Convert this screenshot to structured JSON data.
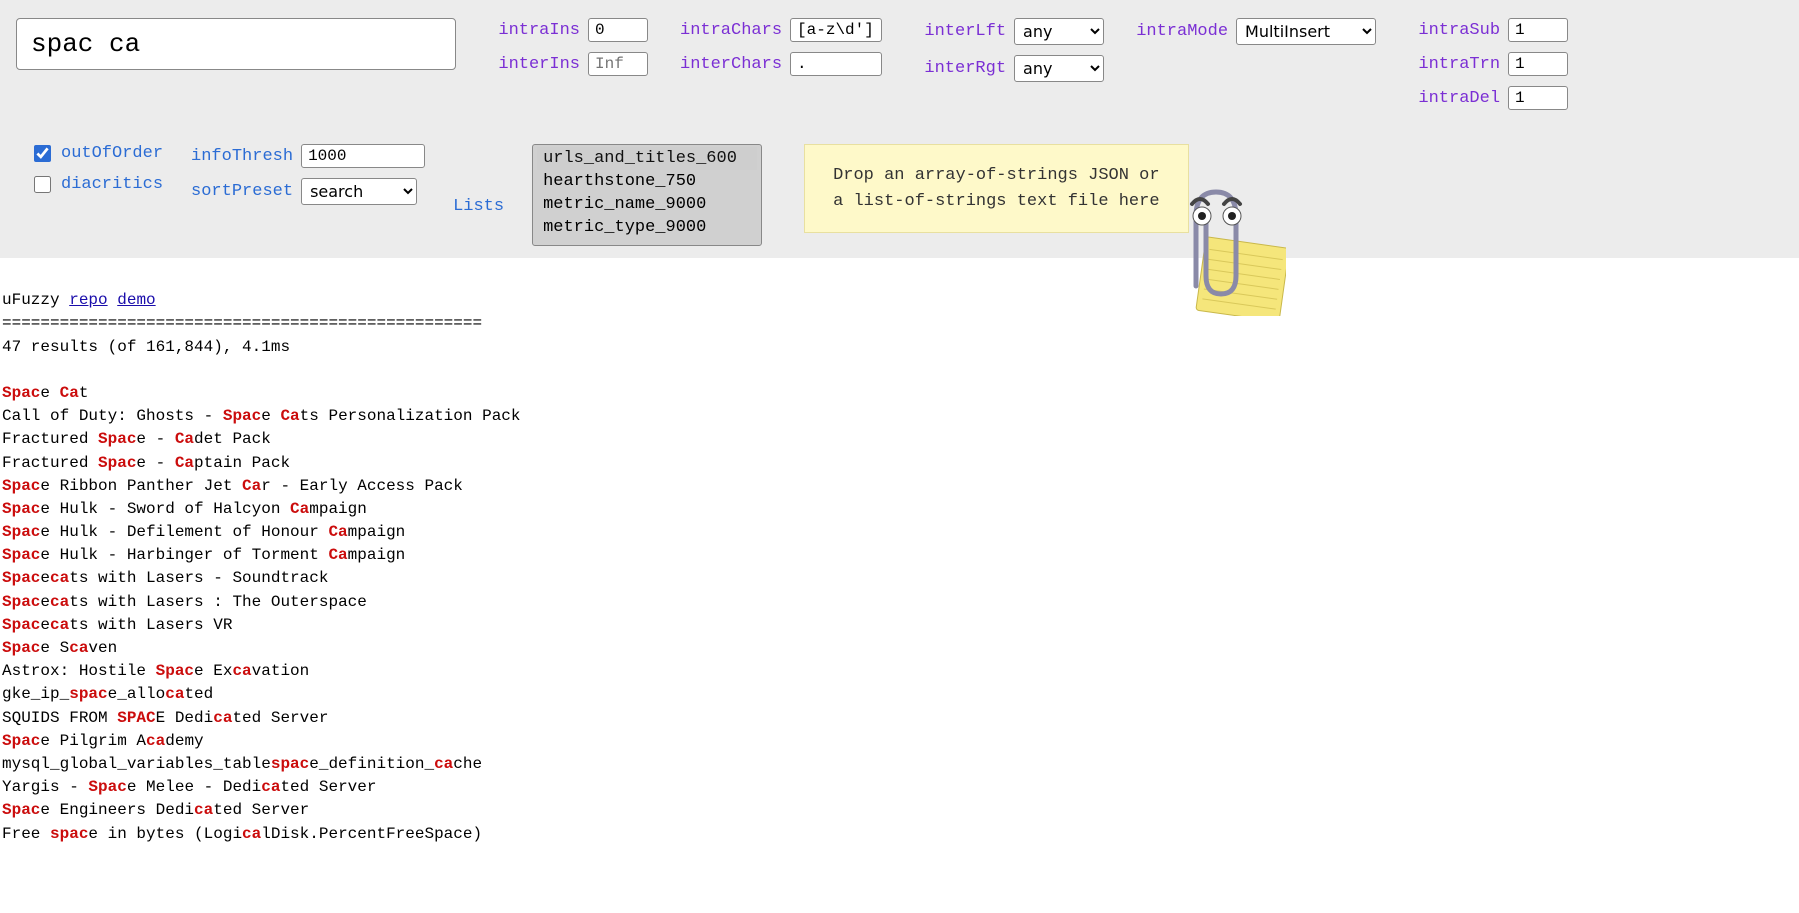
{
  "search": {
    "value": "spac ca"
  },
  "intraIns": {
    "label": "intraIns",
    "value": "0"
  },
  "interIns": {
    "label": "interIns",
    "placeholder": "Inf"
  },
  "intraChars": {
    "label": "intraChars",
    "value": "[a-z\\d']"
  },
  "interChars": {
    "label": "interChars",
    "value": "."
  },
  "interLft": {
    "label": "interLft",
    "value": "any"
  },
  "interRgt": {
    "label": "interRgt",
    "value": "any"
  },
  "intraMode": {
    "label": "intraMode",
    "value": "MultiInsert"
  },
  "intraSub": {
    "label": "intraSub",
    "value": "1"
  },
  "intraTrn": {
    "label": "intraTrn",
    "value": "1"
  },
  "intraDel": {
    "label": "intraDel",
    "value": "1"
  },
  "outOfOrder": {
    "label": "outOfOrder",
    "checked": true
  },
  "diacritics": {
    "label": "diacritics",
    "checked": false
  },
  "infoThresh": {
    "label": "infoThresh",
    "value": "1000"
  },
  "sortPreset": {
    "label": "sortPreset",
    "value": "search"
  },
  "lists": {
    "label": "Lists",
    "items": [
      "urls_and_titles_600",
      "hearthstone_750",
      "metric_name_9000",
      "metric_type_9000"
    ],
    "selected": "urls_and_titles_600"
  },
  "dropZone": {
    "line1": "Drop an array-of-strings JSON or",
    "line2": "a list-of-strings text file here"
  },
  "header": {
    "name": "uFuzzy",
    "repo": "repo",
    "demo": "demo",
    "divider": "==================================================",
    "summary": "47 results (of 161,844), 4.1ms"
  },
  "results": [
    {
      "segs": [
        [
          "Spac",
          1
        ],
        [
          "e ",
          0
        ],
        [
          "Ca",
          1
        ],
        [
          "t",
          0
        ]
      ]
    },
    {
      "segs": [
        [
          "Call of Duty: Ghosts - ",
          0
        ],
        [
          "Spac",
          1
        ],
        [
          "e ",
          0
        ],
        [
          "Ca",
          1
        ],
        [
          "ts Personalization Pack",
          0
        ]
      ]
    },
    {
      "segs": [
        [
          "Fractured ",
          0
        ],
        [
          "Spac",
          1
        ],
        [
          "e - ",
          0
        ],
        [
          "Ca",
          1
        ],
        [
          "det Pack",
          0
        ]
      ]
    },
    {
      "segs": [
        [
          "Fractured ",
          0
        ],
        [
          "Spac",
          1
        ],
        [
          "e - ",
          0
        ],
        [
          "Ca",
          1
        ],
        [
          "ptain Pack",
          0
        ]
      ]
    },
    {
      "segs": [
        [
          "Spac",
          1
        ],
        [
          "e Ribbon Panther Jet ",
          0
        ],
        [
          "Ca",
          1
        ],
        [
          "r - Early Access Pack",
          0
        ]
      ]
    },
    {
      "segs": [
        [
          "Spac",
          1
        ],
        [
          "e Hulk - Sword of Halcyon ",
          0
        ],
        [
          "Ca",
          1
        ],
        [
          "mpaign",
          0
        ]
      ]
    },
    {
      "segs": [
        [
          "Spac",
          1
        ],
        [
          "e Hulk - Defilement of Honour ",
          0
        ],
        [
          "Ca",
          1
        ],
        [
          "mpaign",
          0
        ]
      ]
    },
    {
      "segs": [
        [
          "Spac",
          1
        ],
        [
          "e Hulk - Harbinger of Torment ",
          0
        ],
        [
          "Ca",
          1
        ],
        [
          "mpaign",
          0
        ]
      ]
    },
    {
      "segs": [
        [
          "Spac",
          1
        ],
        [
          "e",
          0
        ],
        [
          "ca",
          1
        ],
        [
          "ts with Lasers - Soundtrack",
          0
        ]
      ]
    },
    {
      "segs": [
        [
          "Spac",
          1
        ],
        [
          "e",
          0
        ],
        [
          "ca",
          1
        ],
        [
          "ts with Lasers : The Outerspace",
          0
        ]
      ]
    },
    {
      "segs": [
        [
          "Spac",
          1
        ],
        [
          "e",
          0
        ],
        [
          "ca",
          1
        ],
        [
          "ts with Lasers VR",
          0
        ]
      ]
    },
    {
      "segs": [
        [
          "Spac",
          1
        ],
        [
          "e S",
          0
        ],
        [
          "ca",
          1
        ],
        [
          "ven",
          0
        ]
      ]
    },
    {
      "segs": [
        [
          "Astrox: Hostile ",
          0
        ],
        [
          "Spac",
          1
        ],
        [
          "e Ex",
          0
        ],
        [
          "ca",
          1
        ],
        [
          "vation",
          0
        ]
      ]
    },
    {
      "segs": [
        [
          "gke_ip_",
          0
        ],
        [
          "spac",
          1
        ],
        [
          "e_allo",
          0
        ],
        [
          "ca",
          1
        ],
        [
          "ted",
          0
        ]
      ]
    },
    {
      "segs": [
        [
          "SQUIDS FROM ",
          0
        ],
        [
          "SPAC",
          1
        ],
        [
          "E Dedi",
          0
        ],
        [
          "ca",
          1
        ],
        [
          "ted Server",
          0
        ]
      ]
    },
    {
      "segs": [
        [
          "Spac",
          1
        ],
        [
          "e Pilgrim A",
          0
        ],
        [
          "ca",
          1
        ],
        [
          "demy",
          0
        ]
      ]
    },
    {
      "segs": [
        [
          "mysql_global_variables_table",
          0
        ],
        [
          "spac",
          1
        ],
        [
          "e_definition_",
          0
        ],
        [
          "ca",
          1
        ],
        [
          "che",
          0
        ]
      ]
    },
    {
      "segs": [
        [
          "Yargis - ",
          0
        ],
        [
          "Spac",
          1
        ],
        [
          "e Melee - Dedi",
          0
        ],
        [
          "ca",
          1
        ],
        [
          "ted Server",
          0
        ]
      ]
    },
    {
      "segs": [
        [
          "Spac",
          1
        ],
        [
          "e Engineers Dedi",
          0
        ],
        [
          "ca",
          1
        ],
        [
          "ted Server",
          0
        ]
      ]
    },
    {
      "segs": [
        [
          "Free ",
          0
        ],
        [
          "spac",
          1
        ],
        [
          "e in bytes (Logi",
          0
        ],
        [
          "ca",
          1
        ],
        [
          "lDisk.PercentFreeSpace)",
          0
        ]
      ]
    }
  ]
}
